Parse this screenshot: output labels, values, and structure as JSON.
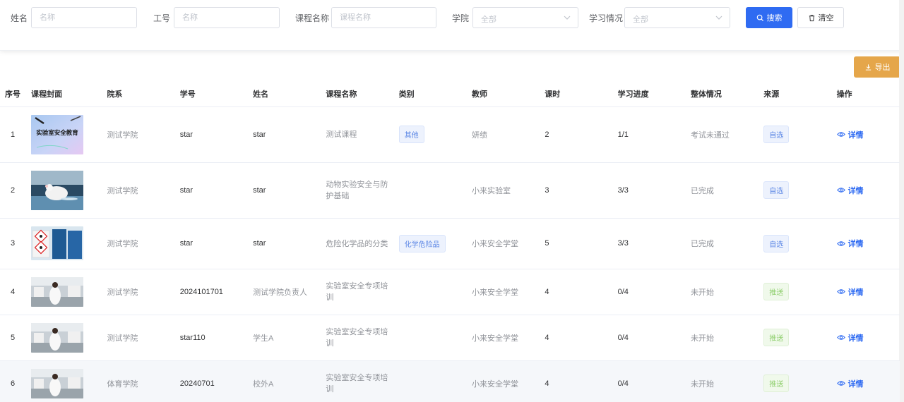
{
  "filters": {
    "name": {
      "label": "姓名",
      "placeholder": "名称"
    },
    "staff_no": {
      "label": "工号",
      "placeholder": "名称"
    },
    "course": {
      "label": "课程名称",
      "placeholder": "课程名称"
    },
    "college": {
      "label": "学院",
      "value": "全部"
    },
    "study": {
      "label": "学习情况",
      "value": "全部"
    },
    "search_label": "搜索",
    "clear_label": "清空"
  },
  "export_label": "导出",
  "colors": {
    "primary": "#2f6bf2",
    "warning": "#e5a64a",
    "tag_blue": "#5b86e5",
    "tag_green": "#8fcf6e"
  },
  "table": {
    "headers": [
      "序号",
      "课程封面",
      "院系",
      "学号",
      "姓名",
      "课程名称",
      "类别",
      "教师",
      "课时",
      "学习进度",
      "整体情况",
      "来源",
      "操作"
    ],
    "rows": [
      {
        "idx": "1",
        "cover": "safety-education-cover",
        "cover_text": "实验室安全教育",
        "dept": "测试学院",
        "sid": "star",
        "name": "star",
        "course": "测试课程",
        "category": "其他",
        "teacher": "妍绩",
        "hours": "2",
        "progress": "1/1",
        "status": "考试未通过",
        "source": "自选",
        "source_type": "blue",
        "action": "详情"
      },
      {
        "idx": "2",
        "cover": "lab-mouse-cover",
        "dept": "测试学院",
        "sid": "star",
        "name": "star",
        "course": "动物实验安全与防护基础",
        "category": "",
        "teacher": "小来实验室",
        "hours": "3",
        "progress": "3/3",
        "status": "已完成",
        "source": "自选",
        "source_type": "blue",
        "action": "详情"
      },
      {
        "idx": "3",
        "cover": "hazard-chemicals-cover",
        "dept": "测试学院",
        "sid": "star",
        "name": "star",
        "course": "危险化学品的分类",
        "category": "化学危险品",
        "teacher": "小来安全学堂",
        "hours": "5",
        "progress": "3/3",
        "status": "已完成",
        "source": "自选",
        "source_type": "blue",
        "action": "详情"
      },
      {
        "idx": "4",
        "cover": "lab-worker-cover",
        "dept": "测试学院",
        "sid": "2024101701",
        "name": "测试学院负责人",
        "course": "实验室安全专项培训",
        "category": "",
        "teacher": "小来安全学堂",
        "hours": "4",
        "progress": "0/4",
        "status": "未开始",
        "source": "推送",
        "source_type": "green",
        "action": "详情"
      },
      {
        "idx": "5",
        "cover": "lab-worker-cover",
        "dept": "测试学院",
        "sid": "star110",
        "name": "学生A",
        "course": "实验室安全专项培训",
        "category": "",
        "teacher": "小来安全学堂",
        "hours": "4",
        "progress": "0/4",
        "status": "未开始",
        "source": "推送",
        "source_type": "green",
        "action": "详情"
      },
      {
        "idx": "6",
        "cover": "lab-worker-cover",
        "dept": "体育学院",
        "sid": "20240701",
        "name": "校外A",
        "course": "实验室安全专项培训",
        "category": "",
        "teacher": "小来安全学堂",
        "hours": "4",
        "progress": "0/4",
        "status": "未开始",
        "source": "推送",
        "source_type": "green",
        "action": "详情"
      }
    ]
  }
}
